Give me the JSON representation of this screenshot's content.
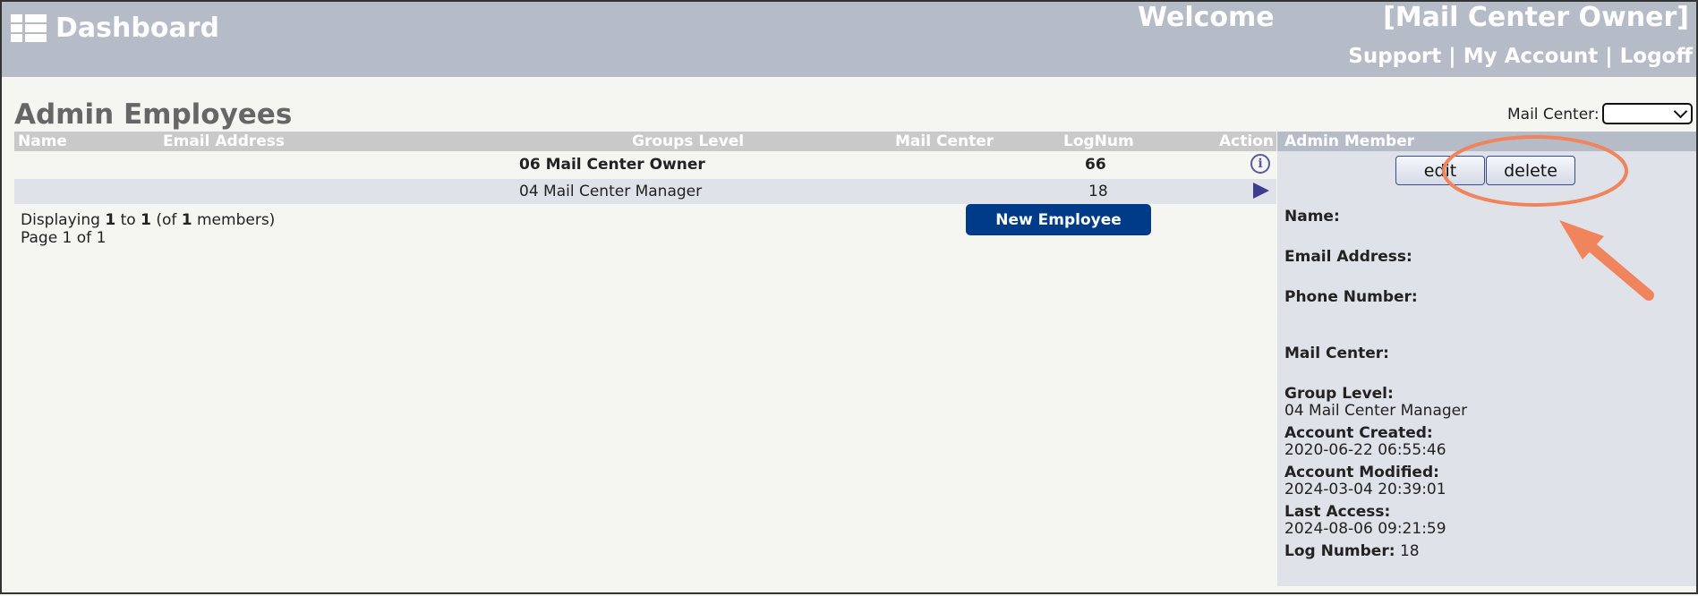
{
  "header": {
    "title": "Dashboard",
    "welcome": "Welcome",
    "user_role": "[Mail Center Owner]",
    "links": [
      "Support",
      "My Account",
      "Logoff"
    ],
    "separator": "|"
  },
  "page": {
    "title": "Admin Employees",
    "mail_center_filter_label": "Mail Center:",
    "mail_center_filter_value": ""
  },
  "table": {
    "columns": [
      "Name",
      "Email Address",
      "Groups Level",
      "Mail Center",
      "LogNum",
      "Action"
    ],
    "rows": [
      {
        "name": "",
        "email": "",
        "group": "06 Mail Center Owner",
        "mail_center": "",
        "lognum": "66",
        "action": "info-icon"
      },
      {
        "name": "",
        "email": "",
        "group": "04 Mail Center Manager",
        "mail_center": "",
        "lognum": "18",
        "action": "play-icon"
      }
    ]
  },
  "pagination": {
    "prefix": "Displaying ",
    "from": "1",
    "to_word": " to ",
    "to": "1",
    "of_open": " (of ",
    "total": "1",
    "of_close": " members)",
    "page_text": "Page 1 of 1"
  },
  "new_employee_label": "New Employee",
  "panel": {
    "title": "Admin Member",
    "edit_label": "edit",
    "delete_label": "delete",
    "name_label": "Name:",
    "email_label": "Email Address:",
    "phone_label": "Phone Number:",
    "mail_center_label": "Mail Center:",
    "group_label": "Group Level:",
    "group_value": "04 Mail Center Manager",
    "created_label": "Account Created:",
    "created_value": "2020-06-22 06:55:46",
    "modified_label": "Account Modified:",
    "modified_value": "2024-03-04 20:39:01",
    "access_label": "Last Access:",
    "access_value": "2024-08-06 09:21:59",
    "lognum_label": "Log Number:",
    "lognum_value": "18"
  },
  "annotation_color": "#f0845c"
}
